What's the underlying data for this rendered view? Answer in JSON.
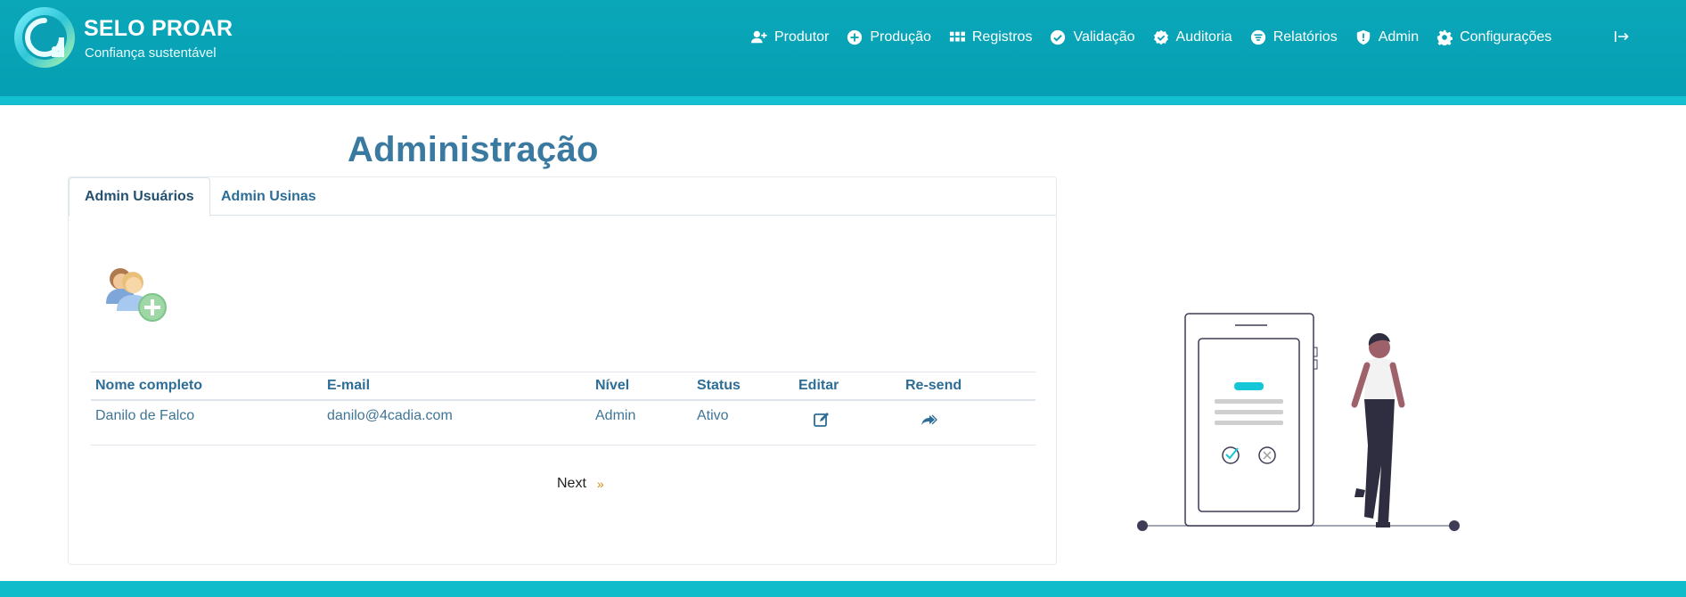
{
  "header": {
    "brand_title": "SELO PROAR",
    "brand_subtitle": "Confiança sustentável",
    "nav": [
      {
        "label": "Produtor",
        "icon": "user-plus-icon"
      },
      {
        "label": "Produção",
        "icon": "plus-circle-icon"
      },
      {
        "label": "Registros",
        "icon": "grid-icon"
      },
      {
        "label": "Validação",
        "icon": "check-circle-icon"
      },
      {
        "label": "Auditoria",
        "icon": "badge-check-icon"
      },
      {
        "label": "Relatórios",
        "icon": "filter-circle-icon"
      },
      {
        "label": "Admin",
        "icon": "shield-icon"
      },
      {
        "label": "Configurações",
        "icon": "gear-icon"
      }
    ],
    "logout_icon": "logout-icon"
  },
  "page": {
    "title": "Administração"
  },
  "tabs": [
    {
      "label": "Admin Usuários",
      "active": true
    },
    {
      "label": "Admin Usinas",
      "active": false
    }
  ],
  "table": {
    "headers": [
      "Nome completo",
      "E-mail",
      "Nível",
      "Status",
      "Editar",
      "Re-send"
    ],
    "rows": [
      {
        "name": "Danilo de Falco",
        "email": "danilo@4cadia.com",
        "level": "Admin",
        "status": "Ativo"
      }
    ]
  },
  "pagination": {
    "next_label": "Next",
    "next_arrow": "»"
  },
  "colors": {
    "header": "#069fb3",
    "accent": "#14bfd0",
    "title": "#3a7aa0",
    "link": "#2d6d96"
  }
}
